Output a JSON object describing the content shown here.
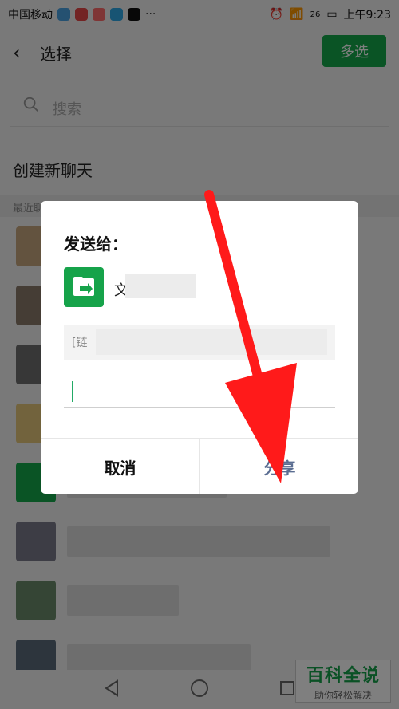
{
  "status": {
    "carrier": "中国移动",
    "signal": "26",
    "time": "上午9:23",
    "app_icons": [
      "msg-icon",
      "mp-icon",
      "app-red-icon",
      "telegram-icon",
      "tiktok-icon"
    ],
    "more": "···"
  },
  "appbar": {
    "title": "选择",
    "multi_select": "多选"
  },
  "search": {
    "placeholder": "搜索"
  },
  "new_chat": "创建新聊天",
  "recent_label": "最近聊天",
  "dialog": {
    "title": "发送给：",
    "target_name": "文",
    "preview_prefix": "[链",
    "cancel": "取消",
    "share": "分享"
  },
  "watermark": {
    "top": "百科全说",
    "bottom": "助你轻松解决"
  },
  "colors": {
    "accent": "#14a84a",
    "share_text": "#5b6e92",
    "arrow": "#ff1a1a"
  }
}
